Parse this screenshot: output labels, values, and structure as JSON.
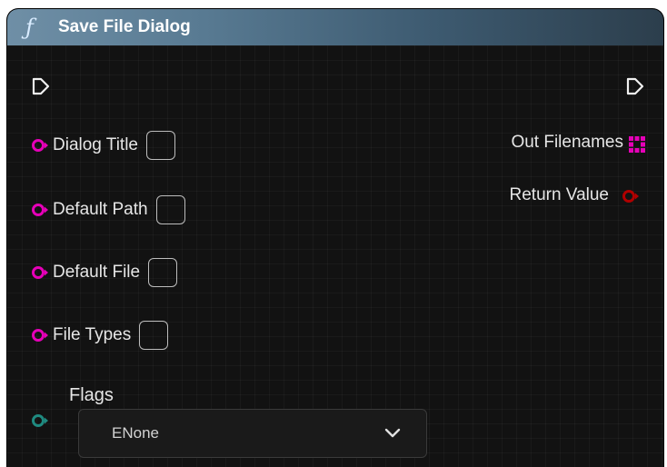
{
  "node": {
    "title": "Save File Dialog",
    "icon": "function-icon",
    "header_color": "#587a92"
  },
  "inputs": [
    {
      "label": "Dialog Title",
      "pin_color": "#e600b8"
    },
    {
      "label": "Default Path",
      "pin_color": "#e600b8"
    },
    {
      "label": "Default File",
      "pin_color": "#e600b8"
    },
    {
      "label": "File Types",
      "pin_color": "#e600b8"
    }
  ],
  "flags": {
    "label": "Flags",
    "value": "ENone",
    "pin_color": "#1f8a80"
  },
  "outputs": [
    {
      "label": "Out Filenames",
      "pin_color": "#e600b8",
      "pin_type": "array"
    },
    {
      "label": "Return Value",
      "pin_color": "#b00000",
      "pin_type": "boolean"
    }
  ]
}
